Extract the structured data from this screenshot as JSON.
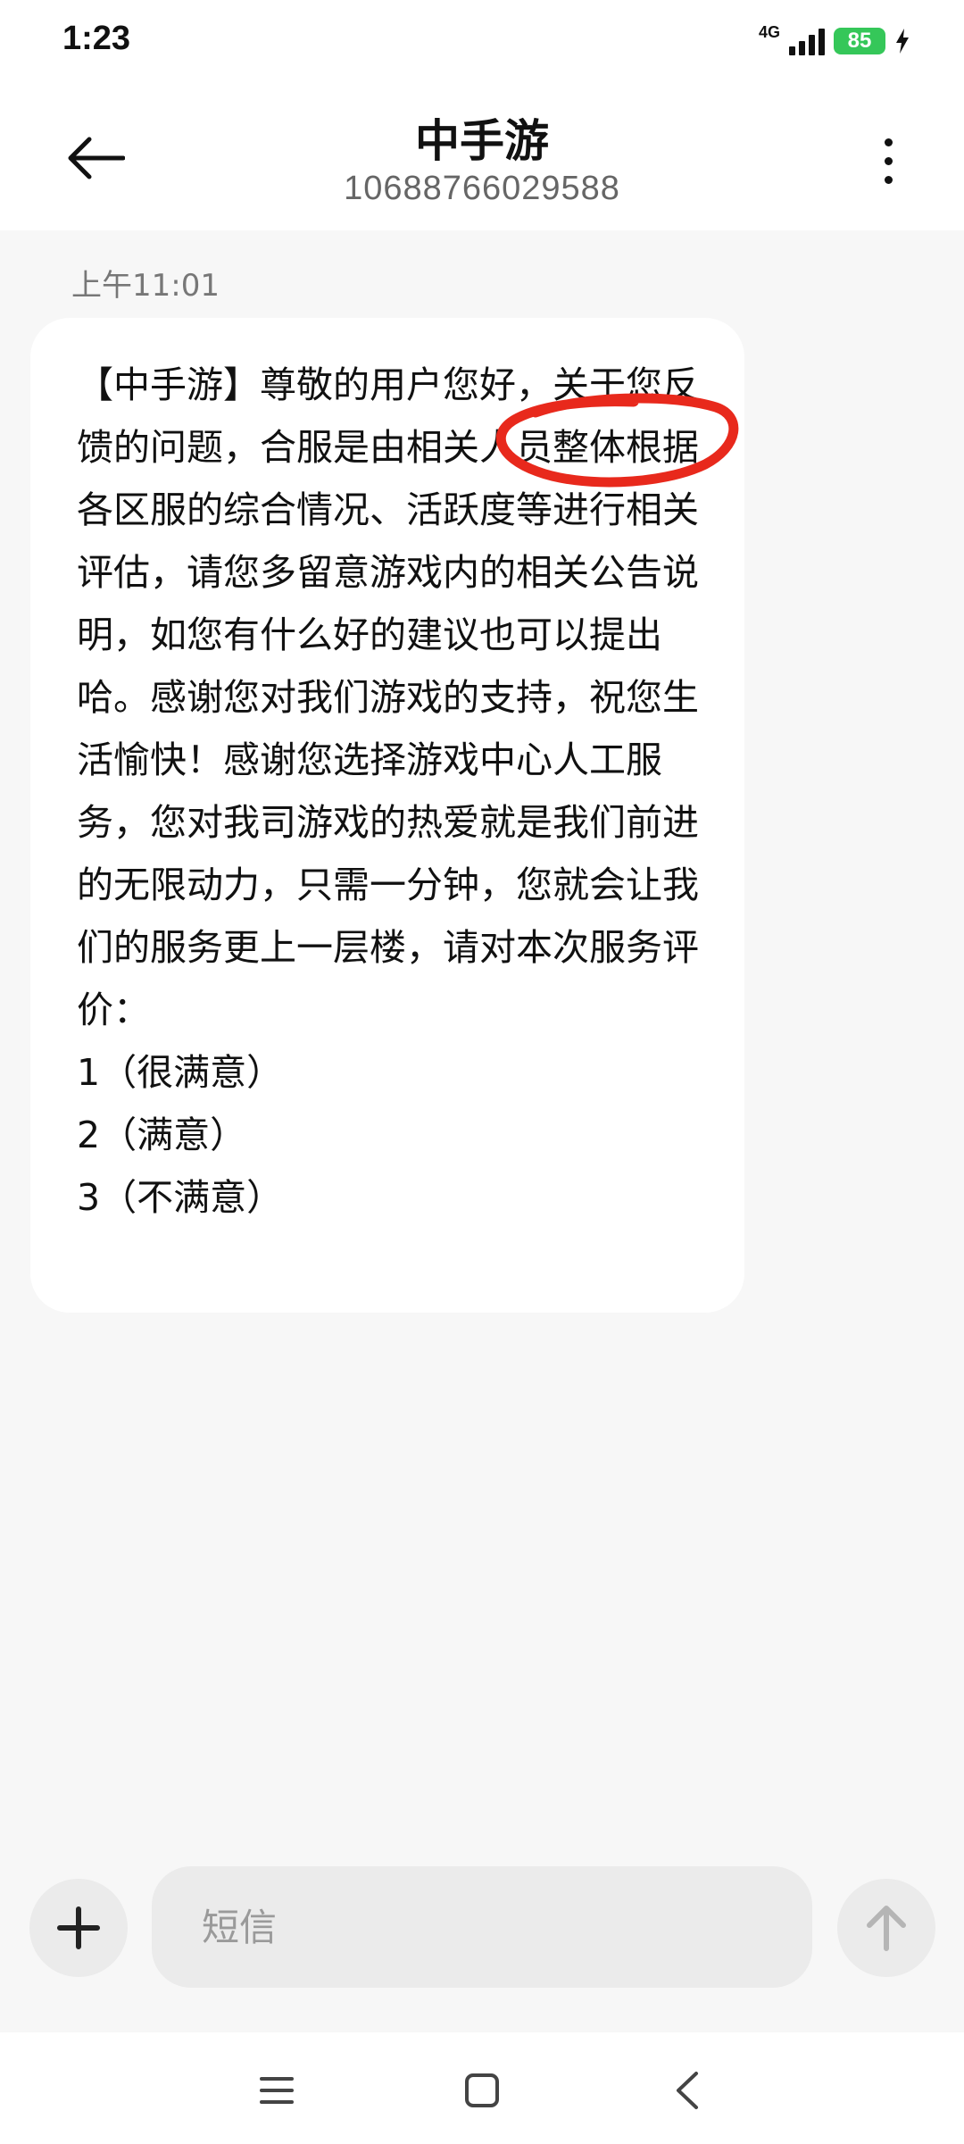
{
  "status_bar": {
    "time": "1:23",
    "network": "4G",
    "battery": "85",
    "icons": [
      "signal-icon",
      "battery-icon",
      "charging-bolt-icon"
    ]
  },
  "header": {
    "title": "中手游",
    "number": "10688766029588",
    "icons": [
      "back-arrow-icon",
      "more-vertical-icon"
    ]
  },
  "conversation": {
    "timestamp": "上午11:01",
    "message": "【中手游】尊敬的用户您好，关于您反馈的问题，合服是由相关人员整体根据各区服的综合情况、活跃度等进行相关评估，请您多留意游戏内的相关公告说明，如您有什么好的建议也可以提出哈。感谢您对我们游戏的支持，祝您生活愉快！感谢您选择游戏中心人工服务，您对我司游戏的热爱就是我们前进的无限动力，只需一分钟，您就会让我们的服务更上一层楼，请对本次服务评价：\n1（很满意）\n2（满意）\n3（不满意）"
  },
  "composer": {
    "placeholder": "短信",
    "icons": [
      "plus-icon",
      "send-arrow-icon"
    ]
  },
  "nav_bar": {
    "icons": [
      "menu-icon",
      "home-square-icon",
      "back-chevron-icon"
    ]
  },
  "colors": {
    "annotation": "#e8291c",
    "battery": "#35c759",
    "background": "#f7f7f7"
  }
}
